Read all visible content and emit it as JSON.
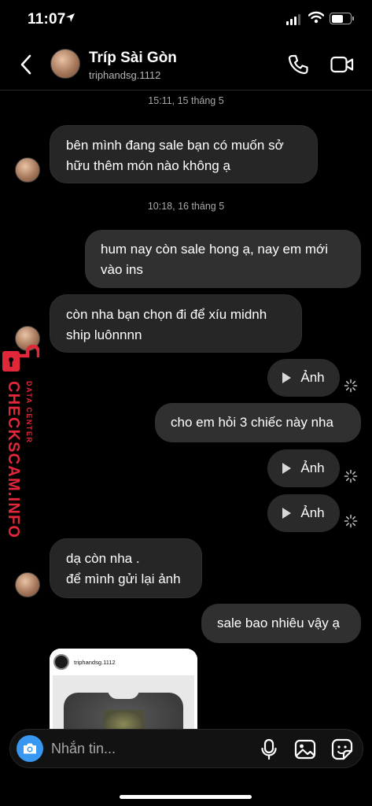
{
  "status_bar": {
    "time": "11:07"
  },
  "header": {
    "name": "Tríp Sài Gòn",
    "username": "triphandsg.1112"
  },
  "timestamps": [
    "15:11, 15 tháng 5",
    "10:18, 16 tháng 5"
  ],
  "messages": [
    {
      "from": "them",
      "text": "bên mình đang sale bạn có muốn sở hữu thêm món nào không ạ"
    },
    {
      "from": "me",
      "text": "hum nay còn sale hong ạ, nay em mới vào ins"
    },
    {
      "from": "them",
      "text": "còn nha bạn chọn đi để xíu midnh ship luônnnn"
    },
    {
      "from": "me",
      "type": "media",
      "label": "Ảnh"
    },
    {
      "from": "me",
      "text": "cho em hỏi 3 chiếc này nha"
    },
    {
      "from": "me",
      "type": "media",
      "label": "Ảnh"
    },
    {
      "from": "me",
      "type": "media",
      "label": "Ảnh"
    },
    {
      "from": "them",
      "text": "dạ còn nha .\nđể mình gửi lại ảnh"
    },
    {
      "from": "me",
      "text": "sale bao nhiêu vậy ạ"
    }
  ],
  "shared_post": {
    "username": "triphandsg.1112"
  },
  "composer": {
    "placeholder": "Nhắn tin..."
  },
  "watermark": {
    "main": "CHECKSCAM.INFO",
    "sub": "DATA CENTER"
  },
  "colors": {
    "accent": "#3897f0",
    "watermark": "#e0283a",
    "bubble_in": "#262626",
    "bubble_out": "#303030"
  }
}
